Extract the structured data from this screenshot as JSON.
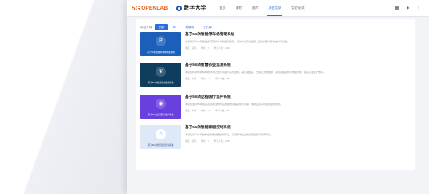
{
  "header": {
    "logo_text": "OPENLAB",
    "university_name": "数字大学",
    "nav": [
      "首页",
      "课程",
      "题库",
      "项目实训",
      "实验论文"
    ],
    "active_nav": "项目实训"
  },
  "filter": {
    "label": "项目方向",
    "chips": [
      "全部",
      "5G",
      "物联网",
      "云计算"
    ],
    "selected": "全部"
  },
  "courses": [
    {
      "title": "基于5G的智能停车场管理系统",
      "desc": "本项目基于5G网络技术实现停车场智能化管理，提供车位实时监测、自动计费与移动支付等功能。",
      "level": "难度：初级",
      "hours": "学时：8",
      "learners": "学习人数：1200",
      "thumb_caption": "基于5G的智能停车场管理系统",
      "thumb_color": "#1c5fb8",
      "icon": "parking-icon"
    },
    {
      "title": "基于5G的智慧农业监测系统",
      "desc": "本项目利用5G物联网技术对农田环境进行实时监测，采集温湿度、光照与土壤数据，实现远程控制与数据分析，提高农业生产效率。",
      "level": "难度：中级",
      "hours": "学时：12",
      "learners": "学习人数：980",
      "thumb_caption": "基于5G的智慧农业监测系统",
      "thumb_color": "#0f3d5e",
      "icon": "leaf-icon"
    },
    {
      "title": "基于5G的远程医疗监护系统",
      "desc": "本项目通过5G网络实现患者生命体征数据的远程采集与传输，帮助医生实时掌握患者状态。",
      "level": "难度：中级",
      "hours": "学时：10",
      "learners": "学习人数：860",
      "thumb_caption": "基于5G的远程医疗监护系统",
      "thumb_color": "#6a3fe0",
      "icon": "signal-icon"
    },
    {
      "title": "基于5G的智能家居控制系统",
      "desc": "本项目基于5G网络构建智能家居控制平台，实现家电设备的远程控制与场景联动。",
      "level": "难度：初级",
      "hours": "学时：8",
      "learners": "学习人数：1050",
      "thumb_caption": "基于5G的智能家居控制系统",
      "thumb_color": "#dfe8f7",
      "icon": "home-icon"
    }
  ]
}
